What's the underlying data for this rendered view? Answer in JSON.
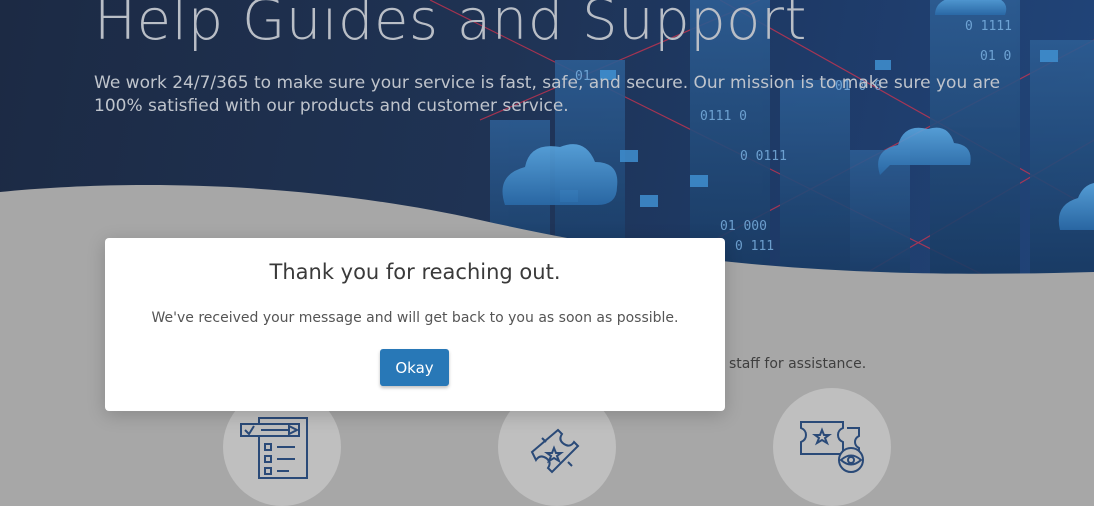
{
  "hero": {
    "title": "Help Guides and Support",
    "subtitle": "We work 24/7/365 to make sure your service is fast, safe, and secure. Our mission is to make sure you are 100% satisfied with our products and customer service."
  },
  "background": {
    "partial_text": "t staff for assistance.",
    "icons": [
      "checklist-icon",
      "ticket-icon",
      "ticket-view-icon"
    ]
  },
  "modal": {
    "title": "Thank you for reaching out.",
    "message": "We've received your message and will get back to you as soon as possible.",
    "okay_label": "Okay"
  },
  "colors": {
    "hero_bg": "#1f3354",
    "accent": "#2878b7",
    "page_bg": "#a7a7a7",
    "icon_stroke": "#2a4a78"
  }
}
